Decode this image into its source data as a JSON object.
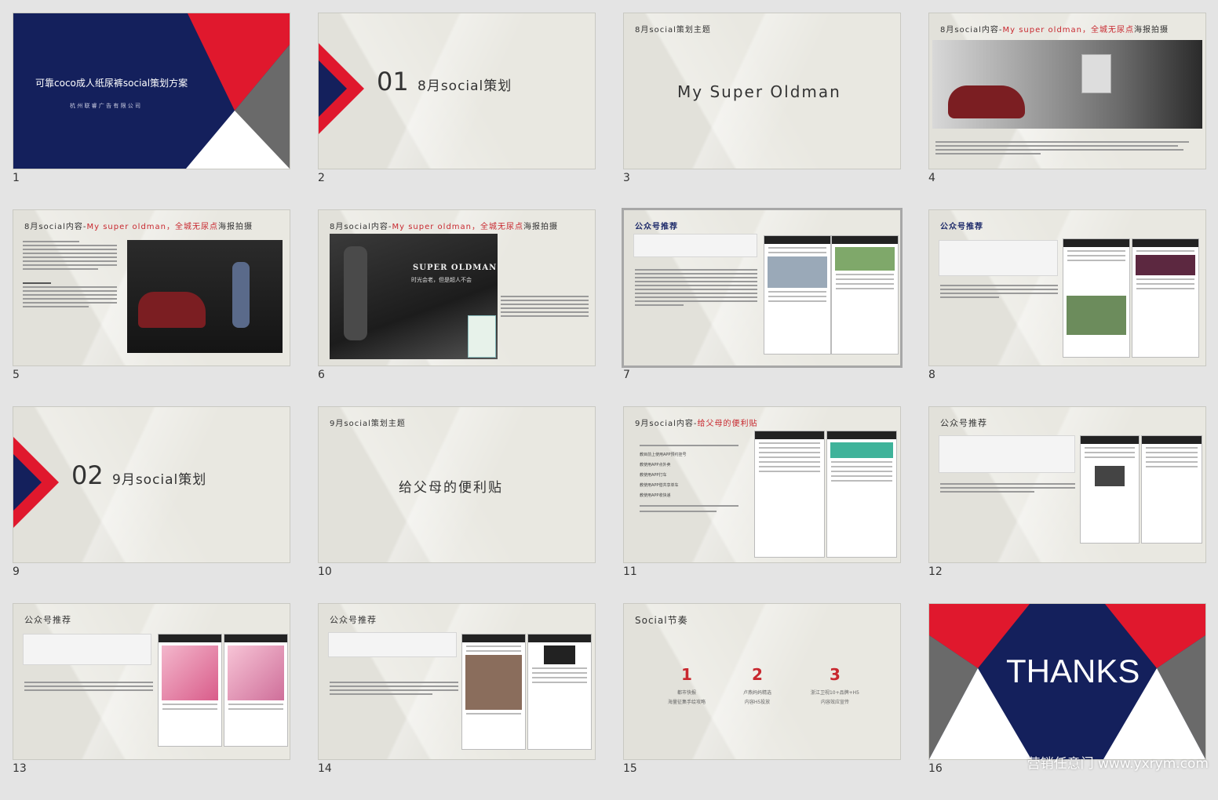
{
  "slides": [
    {
      "num": "1",
      "title": "可靠coco成人纸尿裤social策划方案",
      "subtitle": "杭 州 联 睿 广 告 有 限 公 司"
    },
    {
      "num": "2",
      "index": "01",
      "title": "8月social策划"
    },
    {
      "num": "3",
      "label": "8月social策划主题",
      "headline": "My Super Oldman"
    },
    {
      "num": "4",
      "label": "8月social内容-",
      "label_red": "My super oldman，全城无尿点",
      "label_tail": "海报拍摄"
    },
    {
      "num": "5",
      "label": "8月social内容-",
      "label_red": "My super oldman，全城无尿点",
      "label_tail": "海报拍摄"
    },
    {
      "num": "6",
      "label": "8月social内容-",
      "label_red": "My super oldman，全城无尿点",
      "label_tail": "海报拍摄",
      "poster_line1": "SUPER OLDMAN",
      "poster_line2": "时光会老，但是超人不会"
    },
    {
      "num": "7",
      "label": "公众号推荐"
    },
    {
      "num": "8",
      "label": "公众号推荐"
    },
    {
      "num": "9",
      "index": "02",
      "title": "9月social策划"
    },
    {
      "num": "10",
      "label": "9月social策划主题",
      "headline": "给父母的便利贴"
    },
    {
      "num": "11",
      "label": "9月social内容-",
      "label_red": "给父母的便利贴",
      "bullets": [
        "教目前上使用APP预约挂号",
        "教使用APP点外卖",
        "教使用APP打车",
        "教使用APP借共享单车",
        "教使用APP收快递"
      ]
    },
    {
      "num": "12",
      "label": "公众号推荐"
    },
    {
      "num": "13",
      "label": "公众号推荐"
    },
    {
      "num": "14",
      "label": "公众号推荐"
    },
    {
      "num": "15",
      "label": "Social节奏",
      "steps": [
        {
          "n": "1",
          "l1": "都市快报",
          "l2": "海量征集手绘攻略"
        },
        {
          "n": "2",
          "l1": "卢燕妈妈精选",
          "l2": "内容H5投放"
        },
        {
          "n": "3",
          "l1": "浙江卫视10+品牌+H5",
          "l2": "内容效应宣传"
        }
      ]
    },
    {
      "num": "16",
      "title": "THANKS"
    }
  ],
  "watermark": "营销任意门 www.yxrym.com",
  "colors": {
    "navy": "#14205c",
    "red": "#e0182d",
    "gray": "#6a6a6a",
    "accent_red": "#c8282f"
  }
}
